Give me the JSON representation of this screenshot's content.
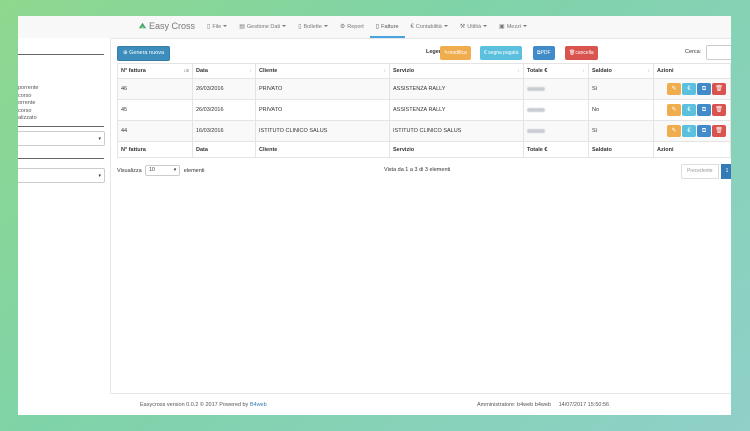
{
  "nav": {
    "brand": "Easy Cross",
    "items": [
      {
        "label": "File",
        "icon": "file-icon"
      },
      {
        "label": "Gestione Dati",
        "icon": "database-icon"
      },
      {
        "label": "Bollette",
        "icon": "document-icon"
      },
      {
        "label": "Report",
        "icon": "gear-icon"
      },
      {
        "label": "Fatture",
        "icon": "document-icon"
      },
      {
        "label": "Contabilità",
        "icon": "euro-icon"
      },
      {
        "label": "Utilità",
        "icon": "wrench-icon"
      },
      {
        "label": "Mezzi",
        "icon": "car-icon"
      }
    ]
  },
  "sidebar": {
    "items": [
      "porrente",
      "corso",
      "orrente",
      "corso",
      "alizzato"
    ]
  },
  "toolbar": {
    "genera": "Genera nuova",
    "legenda": "Legenda:",
    "modifica": "modifica",
    "segna_pagata": "segna pagata",
    "pdf": "PDF",
    "cancella": "cancella",
    "cerca": "Cerca:"
  },
  "table": {
    "columns": [
      "N° fattura",
      "Data",
      "Cliente",
      "Servizio",
      "Totale €",
      "Saldato",
      "Azioni"
    ],
    "rows": [
      {
        "num": "46",
        "data": "26/03/2016",
        "cliente": "PRIVATO",
        "servizio": "ASSISTENZA RALLY",
        "saldato": "Sì"
      },
      {
        "num": "45",
        "data": "26/03/2016",
        "cliente": "PRIVATO",
        "servizio": "ASSISTENZA RALLY",
        "saldato": "No"
      },
      {
        "num": "44",
        "data": "16/03/2016",
        "cliente": "ISTITUTO CLINICO SALUS",
        "servizio": "ISTITUTO CLINICO SALUS",
        "saldato": "Sì"
      }
    ]
  },
  "pager": {
    "visualizza": "Visualizza",
    "page_size": "10",
    "elementi": "elementi",
    "info": "Vista da 1 a 3 di 3 elementi",
    "prev": "Precedente",
    "current": "1"
  },
  "footer": {
    "version": "Easycross version 0.0.2 © 2017 Powered by",
    "powered_link": "B4web",
    "admin": "Amministratore: b4web b4web",
    "datetime": "14/07/2017 15:50:56"
  }
}
